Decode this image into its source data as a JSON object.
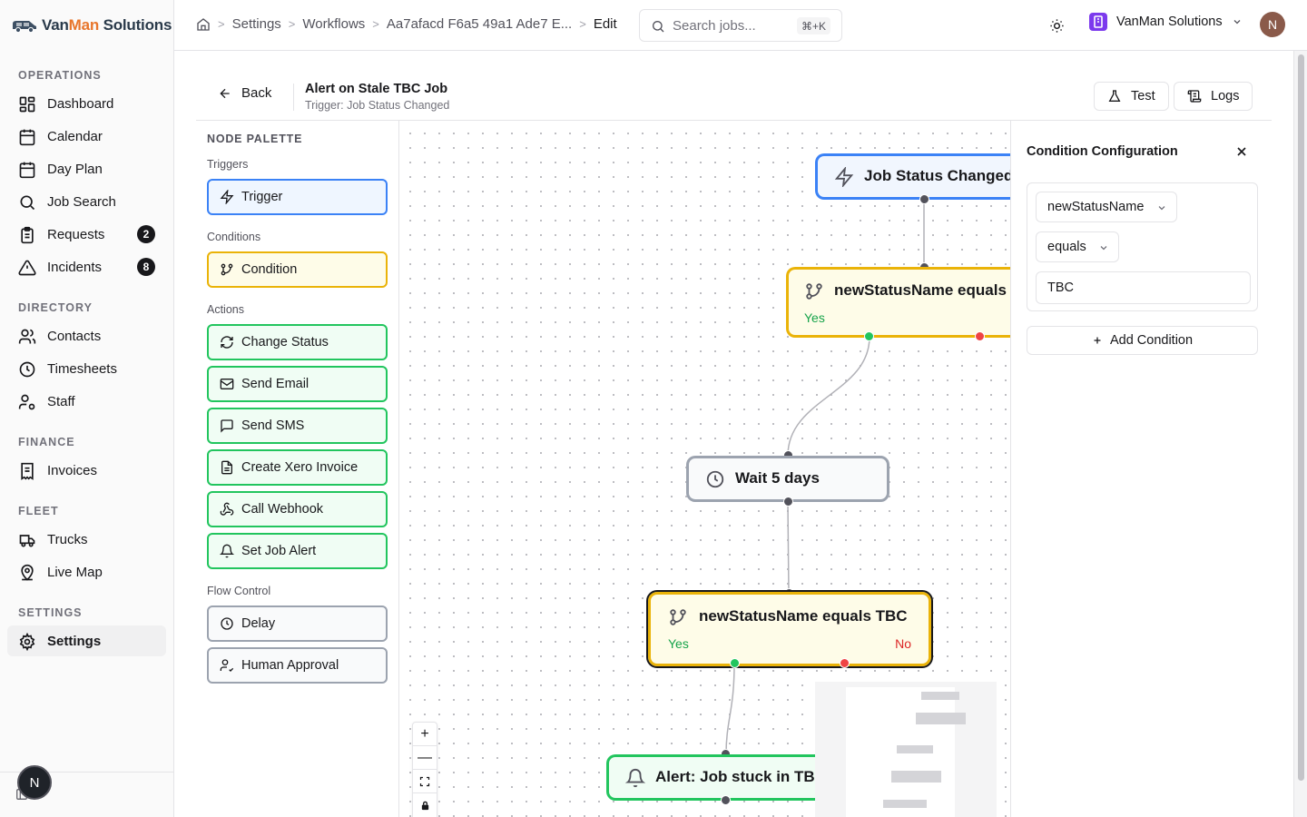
{
  "brand": {
    "name_part1": "Van",
    "name_part2": "Man",
    "name_part3": " Solutions",
    "accent_color": "#e8762c"
  },
  "sidebar": {
    "sections": [
      {
        "label": "OPERATIONS"
      },
      {
        "label": "DIRECTORY"
      },
      {
        "label": "FINANCE"
      },
      {
        "label": "FLEET"
      },
      {
        "label": "SETTINGS"
      }
    ],
    "items": [
      {
        "label": "Dashboard",
        "icon": "layout-dashboard-icon"
      },
      {
        "label": "Calendar",
        "icon": "calendar-icon"
      },
      {
        "label": "Day Plan",
        "icon": "calendar-days-icon"
      },
      {
        "label": "Job Search",
        "icon": "search-icon"
      },
      {
        "label": "Requests",
        "icon": "clipboard-list-icon",
        "badge": "2"
      },
      {
        "label": "Incidents",
        "icon": "alert-triangle-icon",
        "badge": "8"
      },
      {
        "label": "Contacts",
        "icon": "users-icon"
      },
      {
        "label": "Timesheets",
        "icon": "clock-icon"
      },
      {
        "label": "Staff",
        "icon": "user-cog-icon"
      },
      {
        "label": "Invoices",
        "icon": "receipt-icon"
      },
      {
        "label": "Trucks",
        "icon": "truck-icon"
      },
      {
        "label": "Live Map",
        "icon": "map-pin-icon"
      },
      {
        "label": "Settings",
        "icon": "settings-icon",
        "active": true
      }
    ],
    "user_initial": "N"
  },
  "topbar": {
    "breadcrumbs": [
      "Settings",
      "Workflows",
      "Aa7afacd F6a5 49a1 Ade7 E...",
      "Edit"
    ],
    "search_placeholder": "Search jobs...",
    "search_shortcut": "⌘+K",
    "org_name": "VanMan Solutions",
    "avatar_initial": "N"
  },
  "editor": {
    "back_label": "Back",
    "title": "Alert on Stale TBC Job",
    "subtitle": "Trigger: Job Status Changed",
    "test_label": "Test",
    "logs_label": "Logs"
  },
  "palette": {
    "title": "NODE PALETTE",
    "groups": {
      "triggers": "Triggers",
      "conditions": "Conditions",
      "actions": "Actions",
      "flow": "Flow Control"
    },
    "trigger": "Trigger",
    "condition": "Condition",
    "actions": [
      "Change Status",
      "Send Email",
      "Send SMS",
      "Create Xero Invoice",
      "Call Webhook",
      "Set Job Alert"
    ],
    "flow": [
      "Delay",
      "Human Approval"
    ]
  },
  "canvas": {
    "nodes": {
      "trigger": "Job Status Changed",
      "condition1": "newStatusName equals TBC",
      "condition1_yes": "Yes",
      "delay": "Wait 5 days",
      "condition2": "newStatusName equals TBC",
      "condition2_yes": "Yes",
      "condition2_no": "No",
      "alert": "Alert: Job stuck in TBC"
    },
    "zoom_controls": {
      "zoom_in": "+",
      "zoom_out": "—"
    }
  },
  "config": {
    "title": "Condition Configuration",
    "field": "newStatusName",
    "operator": "equals",
    "value": "TBC",
    "add_label": "Add Condition"
  },
  "colors": {
    "trigger": "#3b82f6",
    "condition": "#eab308",
    "action": "#22c55e",
    "flow": "#9ca3af",
    "yes": "#22c55e",
    "no": "#ef4444"
  }
}
